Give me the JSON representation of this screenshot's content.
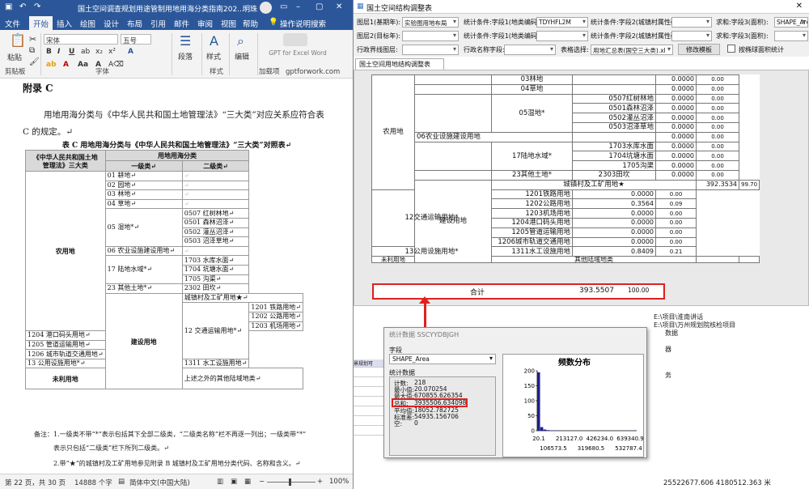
{
  "word": {
    "title": "国土空间调查规划用途管制用地用海分类指南202...",
    "user": "明珠",
    "menu": [
      "文件",
      "开始",
      "插入",
      "绘图",
      "设计",
      "布局",
      "引用",
      "邮件",
      "审阅",
      "视图",
      "帮助",
      "操作说明搜索"
    ],
    "ribbon": {
      "paste": "粘贴",
      "clipboard": "剪贴板",
      "font_name": "宋体",
      "font_size": "五号",
      "font_group": "字体",
      "paragraph": "段落",
      "styles": "样式",
      "editing": "编辑",
      "gpt": "GPT for Excel Word",
      "addins": "加载项",
      "gpt2": "gptforwork.com"
    },
    "heading": "附录 C",
    "para1": "用地用海分类与《中华人民共和国土地管理法》“三大类”对应关系应符合表",
    "para2": "C 的规定。↵",
    "caption": "表 C 用地用海分类与《中华人民共和国土地管理法》“三大类”对照表↵",
    "table": {
      "h1": "《中华人民共和国土地",
      "h1b": "管理法》三大类",
      "h2": "用地用海分类",
      "h3": "一级类↵",
      "h4": "二级类↵",
      "cat1": "农用地",
      "cat2": "建设用地",
      "cat3": "未利用地",
      "r01": "01 耕地↵",
      "r02": "02 园地↵",
      "r03": "03 林地↵",
      "r04": "04 草地↵",
      "r05": "05 湿地*↵",
      "r0507": "0507 红树林地↵",
      "r0501": "0501 森林沼泽↵",
      "r0502": "0502 灌丛沼泽↵",
      "r0503": "0503 沼泽草地↵",
      "r06": "06 农业设施建设用地↵",
      "r17": "17 陆地水域*↵",
      "r1703": "1703 水库水面↵",
      "r1704": "1704 坑塘水面↵",
      "r1705": "1705 沟渠↵",
      "r23": "23 其他土地*↵",
      "r2302": "2302 田坎↵",
      "rcz": "城镇村及工矿用地★↵",
      "r12": "12 交通运输用地*↵",
      "r1201": "1201 铁路用地↵",
      "r1202": "1202 公路用地↵",
      "r1203": "1203 机场用地↵",
      "r1204": "1204 港口码头用地↵",
      "r1205": "1205 管道运输用地↵",
      "r1206": "1206 城市轨道交通用地↵",
      "r13": "13 公用设施用地*↵",
      "r1311": "1311 水工设施用地↵",
      "rother": "上述之外的其他陆域地类↵"
    },
    "note1": "备注：1.一级类不带“*”表示包括其下全部二级类，“二级类名称”栏不再逐一列出；一级类带“*”",
    "note2": "表示只包括“二级类”栏下所列二级类。↵",
    "note3": "2.带“★”的城镇村及工矿用地参见附录 B 城镇村及工矿用地分类代码、名称和含义。↵",
    "status": {
      "page": "第 22 页，共 30 页",
      "words": "14888 个字",
      "lang": "简体中文(中国大陆)",
      "zoom": "100%"
    }
  },
  "gis": {
    "title": "国土空间结构调整表",
    "form": {
      "l1": "图层1(基期年):",
      "s1": "实验图用地布局",
      "l2": "统计条件:字段1(地类编码):",
      "s2": "TDYHFL2M",
      "l3": "统计条件:字段2(城镇村属性码):",
      "l4": "求和:字段3(面积):",
      "s4": "SHAPE_Area",
      "l5": "图层2(目标年):",
      "l6": "统计条件:字段1(地类编码):",
      "l7": "统计条件:字段2(城镇村属性码):",
      "l8": "求和:字段3(面积):",
      "l9": "行政界线图层:",
      "l10": "行政名称字段:",
      "l11": "表格选择:",
      "s11": "用地汇总表(国空三大类).xl",
      "btn": "修改模板",
      "chk": "按椭球面积统计"
    },
    "tab": "国土空间用地结构调整表",
    "rows": {
      "nong": "农用地",
      "jianshe": "建设用地",
      "weili": "未利用地",
      "a03": "03林地",
      "a04": "04草地",
      "a05": "05湿地*",
      "a0507": "0507红树林地",
      "a0501": "0501森林沼泽",
      "a0502": "0502灌丛沼泽",
      "a0503": "0503沼泽草地",
      "a06": "06农业设施建设用地",
      "a17": "17陆地水域*",
      "a1703": "1703水库水面",
      "a1704": "1704坑塘水面",
      "a1705": "1705沟渠",
      "a23": "23其他土地*",
      "a2303": "2303田坎",
      "acz": "城镇村及工矿用地★",
      "a12": "12交通运输用地*",
      "a1201": "1201铁路用地",
      "a1202": "1202公路用地",
      "a1203": "1203机场用地",
      "a1204": "1204港口码头用地",
      "a1205": "1205管道运输用地",
      "a1206": "1206城市轨道交通用地",
      "a13": "13公用设施用地*",
      "a1311": "1311水工设施用地",
      "aother": "其他陆域地类",
      "zero": "0.0000",
      "zeropct": "0.00",
      "cz_val": "392.3534",
      "cz_pct": "99.70",
      "v1202": "0.3564",
      "p1202": "0.09",
      "v1311": "0.8409",
      "p1311": "0.21",
      "sum_label": "合计",
      "sum_val": "393.5507",
      "sum_pct": "100.00"
    },
    "bg": {
      "t1": "E:\\项目\\淮南讲话",
      "t2": "E:\\项目\\万州规划院核检项目",
      "t3": "数据",
      "t4": "器",
      "t5": "务",
      "l1": "景规划可"
    },
    "coords": "25522677.606  4180512.363 米",
    "dialog": {
      "title": "统计数据 SSCYYDBJGH",
      "field_label": "字段",
      "field": "SHAPE_Area",
      "stats_label": "统计数据",
      "k_count": "计数:",
      "v_count": "218",
      "k_min": "最小值:",
      "v_min": "20.070254",
      "k_max": "最大值:",
      "v_max": "670855.626354",
      "k_sum": "总和:",
      "v_sum": "3935506.634098",
      "k_mean": "平均值:",
      "v_mean": "18052.782725",
      "k_std": "标准差:",
      "v_std": "54935.156706",
      "k_null": "空:",
      "v_null": "0",
      "hist_title": "频数分布"
    }
  },
  "chart_data": {
    "type": "bar",
    "title": "频数分布",
    "ylim": [
      0,
      200
    ],
    "yticks": [
      0,
      50,
      100,
      150,
      200
    ],
    "xticks_top": [
      "20.1",
      "213127.0",
      "426234.0",
      "639340.9"
    ],
    "xticks_bottom": [
      "106573.5",
      "319680.5",
      "532787.4"
    ],
    "values": [
      195,
      12,
      4,
      2,
      1,
      1,
      1,
      0,
      0,
      0,
      0,
      0,
      0,
      0,
      0,
      0,
      0,
      0,
      0,
      0,
      0,
      0,
      0,
      0,
      0,
      0,
      0,
      0,
      0,
      0,
      0,
      1
    ],
    "bar_color": "#1e1e8c"
  }
}
